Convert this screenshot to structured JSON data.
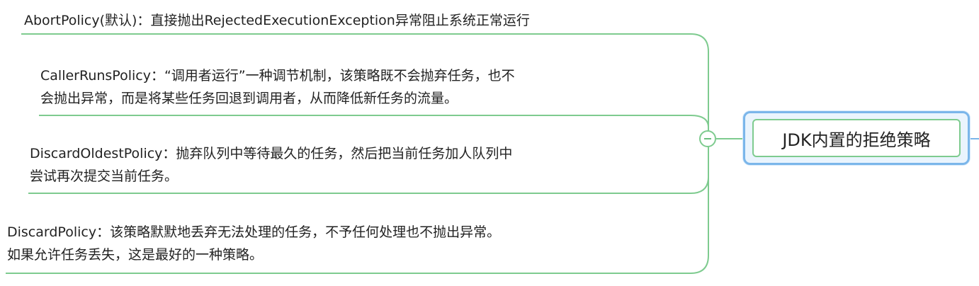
{
  "root": {
    "label": "JDK内置的拒绝策略"
  },
  "branches": [
    {
      "term": "AbortPolicy(默认)：",
      "lines": [
        "直接抛出RejectedExecutionException异常阻止系统正常运行"
      ]
    },
    {
      "term": "CallerRunsPolicy：",
      "lines": [
        "“调用者运行”一种调节机制，该策略既不会抛弃任务，也不",
        "会抛出异常，而是将某些任务回退到调用者，从而降低新任务的流量。"
      ]
    },
    {
      "term": "DiscardOldestPolicy：",
      "lines": [
        "抛弃队列中等待最久的任务，然后把当前任务加人队列中",
        "尝试再次提交当前任务。"
      ]
    },
    {
      "term": "DiscardPolicy：",
      "lines": [
        "该策略默默地丢弃无法处理的任务，不予任何处理也不抛出异常。",
        "如果允许任务丢失，这是最好的一种策略。"
      ]
    }
  ],
  "colors": {
    "connector": "#7ecb8f",
    "root_border": "#7bb6ea",
    "root_fill": "#eaf4fd"
  }
}
